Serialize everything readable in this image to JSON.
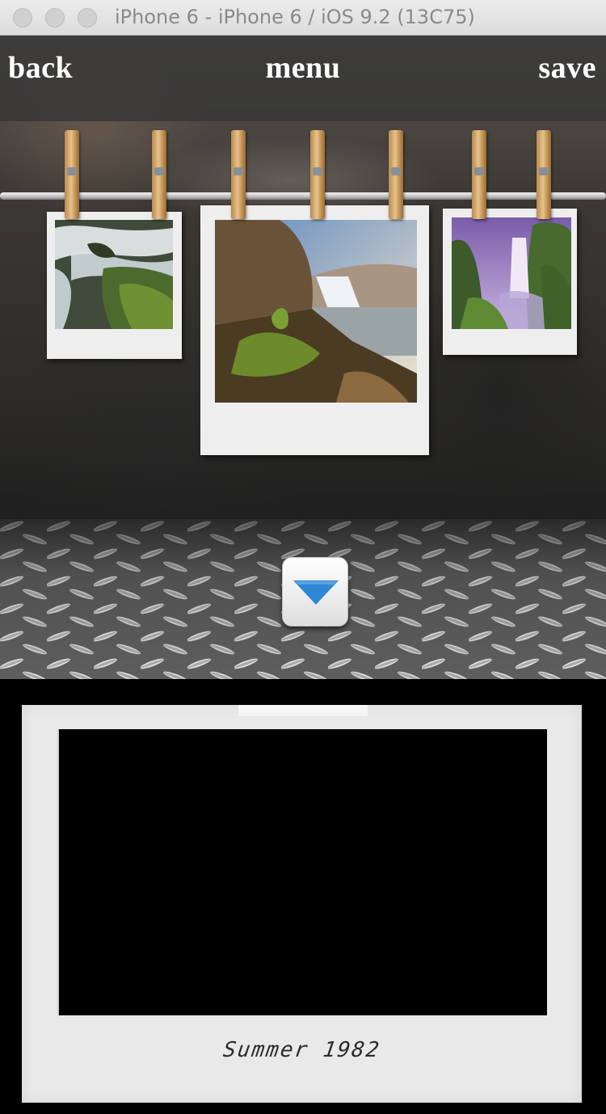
{
  "window": {
    "title": "iPhone 6 - iPhone 6 / iOS 9.2 (13C75)"
  },
  "navbar": {
    "back_label": "back",
    "menu_label": "menu",
    "save_label": "save"
  },
  "gallery": {
    "photos": [
      {
        "subject": "waterfall-rocks"
      },
      {
        "subject": "waterfall-cliffs"
      },
      {
        "subject": "waterfall-purple-sky"
      }
    ]
  },
  "toggle": {
    "icon": "triangle-down-icon",
    "color": "#2f87d6"
  },
  "preview": {
    "caption": "Summer 1982"
  }
}
